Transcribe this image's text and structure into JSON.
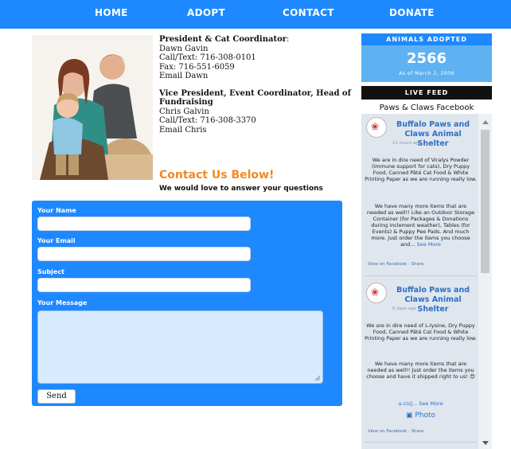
{
  "nav": {
    "home": "HOME",
    "adopt": "ADOPT",
    "contact": "CONTACT",
    "donate": "DONATE"
  },
  "contact_info": {
    "president_title": "President & Cat Coordinator",
    "president_name": "Dawn Gavin",
    "president_phone": "Call/Text: 716-308-0101",
    "president_fax": "Fax: 716-551-6059",
    "president_email": "Email Dawn",
    "vp_title": "Vice President, Event Coordinator, Head of Fundraising",
    "vp_name": "Chris Galvin",
    "vp_phone": "Call/Text: 716-308-3370",
    "vp_email": "Email Chris"
  },
  "contact_cta": {
    "heading": "Contact Us Below!",
    "subheading": "We would love to answer your questions"
  },
  "form": {
    "name_label": "Your Name",
    "email_label": "Your Email",
    "subject_label": "Subject",
    "message_label": "Your Message",
    "send_label": "Send"
  },
  "adopted": {
    "header": "ANIMALS ADOPTED",
    "count": "2566",
    "since": "As of March 2, 2009"
  },
  "live_feed": {
    "label": "LIVE FEED",
    "page_title": "Paws & Claws Facebook",
    "posts": [
      {
        "author": "Buffalo Paws and Claws Animal Shelter",
        "time": "11 hours ago",
        "paragraph1": "We are in dire need of Viralys Powder (immune support for cats), Dry Puppy Food, Canned Pâté Cat Food & White Printing Paper as we are running really low.",
        "paragraph2": "We have many more items that are needed as well!! Like an Outdoor Storage Container (for Packages & Donations during inclement weather), Tables (for Events) & Puppy Pee Pads. And much more. Just order the items you choose and...",
        "see_more": "See More",
        "footer": "View on Facebook · Share"
      },
      {
        "author": "Buffalo Paws and Claws Animal Shelter",
        "time": "6 days ago",
        "paragraph1": "We are in dire need of L-lysine, Dry Puppy Food, Canned Pâté Cat Food & White Printing Paper as we are running really low.",
        "paragraph2": "We have many more items that are needed as well!! Just order the items you choose and have it shipped right to us! 😍",
        "link": "a.co/j...",
        "see_more": "See More",
        "photo": "Photo",
        "footer": "View on Facebook · Share"
      }
    ]
  },
  "colors": {
    "nav_blue": "#1e88ff",
    "accent_orange": "#f08a24",
    "adopt_light": "#5eb2f1"
  }
}
